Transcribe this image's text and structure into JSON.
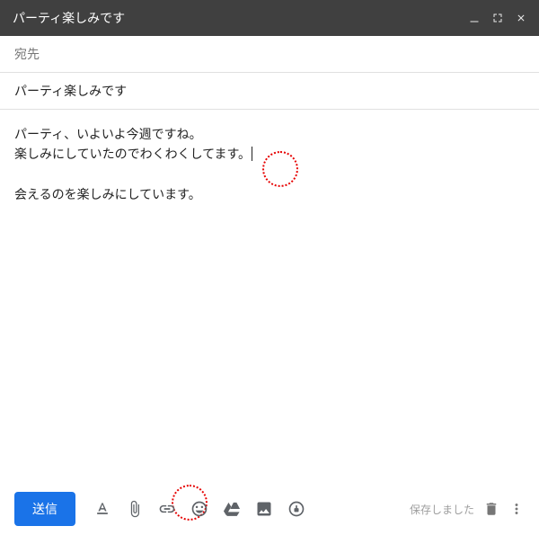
{
  "header": {
    "title": "パーティ楽しみです"
  },
  "recipients": {
    "label": "宛先"
  },
  "subject": {
    "text": "パーティ楽しみです"
  },
  "body": {
    "line1": "パーティ、いよいよ今週ですね。",
    "line2": "楽しみにしていたのでわくわくしてます。",
    "line3": "会えるのを楽しみにしています。"
  },
  "footer": {
    "send_label": "送信",
    "saved_label": "保存しました"
  }
}
